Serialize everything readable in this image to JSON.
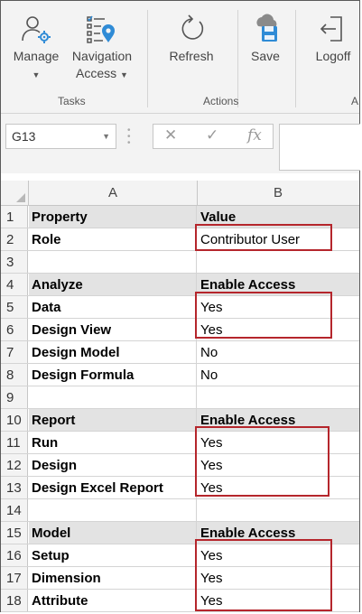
{
  "ribbon": {
    "buttons": {
      "manage": "Manage",
      "navigation_line1": "Navigation",
      "navigation_line2": "Access",
      "refresh": "Refresh",
      "save": "Save",
      "logoff": "Logoff"
    },
    "groups": {
      "tasks": "Tasks",
      "actions": "Actions",
      "truncated": "A"
    }
  },
  "formula_bar": {
    "name_box": "G13",
    "cancel_glyph": "✕",
    "enter_glyph": "✓",
    "fx_glyph": "fx"
  },
  "sheet": {
    "columns": [
      "A",
      "B"
    ],
    "rows": [
      {
        "num": "1",
        "a": "Property",
        "b": "Value",
        "header": true
      },
      {
        "num": "2",
        "a": "Role",
        "b": "Contributor User",
        "header": false
      },
      {
        "num": "3",
        "a": "",
        "b": "",
        "header": false
      },
      {
        "num": "4",
        "a": "Analyze",
        "b": "Enable Access",
        "header": true
      },
      {
        "num": "5",
        "a": "Data",
        "b": "Yes",
        "header": false
      },
      {
        "num": "6",
        "a": "Design View",
        "b": "Yes",
        "header": false
      },
      {
        "num": "7",
        "a": "Design Model",
        "b": "No",
        "header": false
      },
      {
        "num": "8",
        "a": "Design Formula",
        "b": "No",
        "header": false
      },
      {
        "num": "9",
        "a": "",
        "b": "",
        "header": false
      },
      {
        "num": "10",
        "a": "Report",
        "b": "Enable Access",
        "header": true
      },
      {
        "num": "11",
        "a": "Run",
        "b": "Yes",
        "header": false
      },
      {
        "num": "12",
        "a": "Design",
        "b": "Yes",
        "header": false
      },
      {
        "num": "13",
        "a": "Design Excel Report",
        "b": "Yes",
        "header": false
      },
      {
        "num": "14",
        "a": "",
        "b": "",
        "header": false
      },
      {
        "num": "15",
        "a": "Model",
        "b": "Enable Access",
        "header": true
      },
      {
        "num": "16",
        "a": "Setup",
        "b": "Yes",
        "header": false
      },
      {
        "num": "17",
        "a": "Dimension",
        "b": "Yes",
        "header": false
      },
      {
        "num": "18",
        "a": "Attribute",
        "b": "Yes",
        "header": false
      }
    ]
  },
  "colors": {
    "highlight": "#b5262c",
    "ribbon_bg": "#f3f3f3",
    "section_bg": "#e3e3e3"
  }
}
